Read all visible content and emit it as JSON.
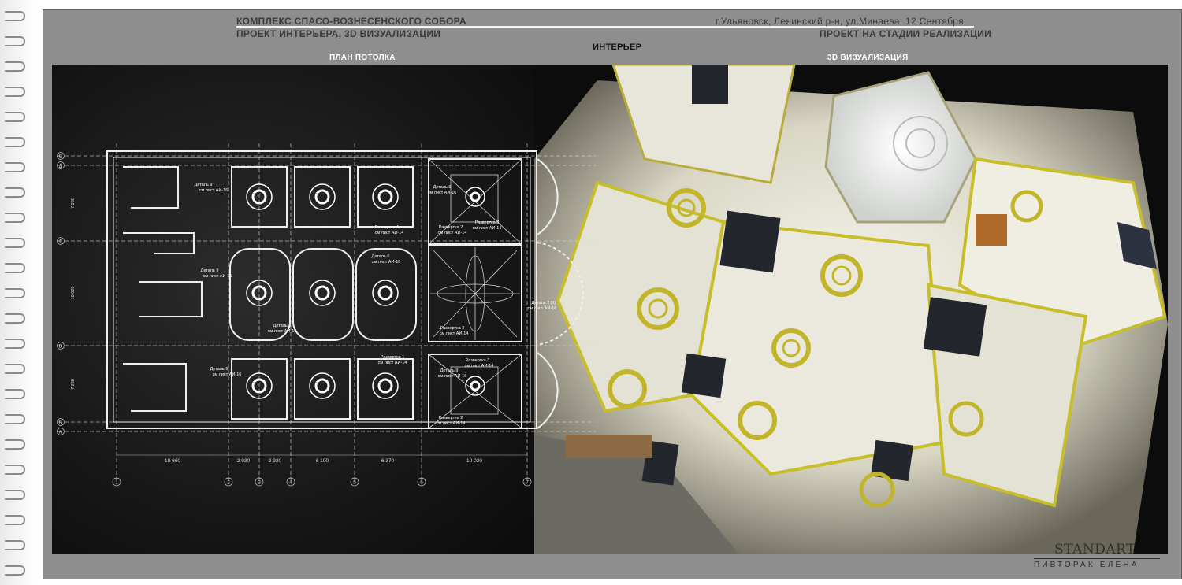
{
  "header": {
    "title_line1": "КОМПЛЕКС СПАСО-ВОЗНЕСЕНСКОГО СОБОРА",
    "title_line2": "ПРОЕКТ ИНТЕРЬЕРА, 3D ВИЗУАЛИЗАЦИИ",
    "address": "г.Ульяновск, Ленинский р-н, ул.Минаева, 12 Сентября",
    "status": "ПРОЕКТ НА СТАДИИ РЕАЛИЗАЦИИ",
    "section": "ИНТЕРЬЕР",
    "left_panel": "ПЛАН ПОТОЛКА",
    "right_panel": "3D ВИЗУАЛИЗАЦИЯ"
  },
  "plan": {
    "row_axes": [
      "Е",
      "Д",
      "Г",
      "В",
      "Б",
      "А"
    ],
    "col_axes": [
      "1",
      "2",
      "3",
      "4",
      "5",
      "6",
      "7"
    ],
    "dimensions_bottom": [
      "10 660",
      "2 930",
      "2 930",
      "6 100",
      "6 370",
      "10 020"
    ],
    "dimensions_left": [
      "7 280",
      "10 020",
      "7 280"
    ],
    "callouts": {
      "detail9_a": "Деталь 9",
      "sheet_a": "см лист АИ-16",
      "detail9_b": "Деталь 9",
      "sheet_b": "см лист АИ-16",
      "detail9_c": "Деталь 9",
      "sheet_c": "см лист АИ-16",
      "detail9_d": "Деталь 9",
      "sheet_d": "см лист АИ-16",
      "detail9_e": "Деталь 9",
      "sheet_e": "см лист АИ-16",
      "detail6": "Деталь 6",
      "sheet_6": "см лист АИ-16",
      "detail8": "Деталь 8",
      "sheet_8": "см лист АИ-16",
      "detail2": "Деталь 2 (1)",
      "sheet_2": "см лист АИ-16",
      "razv1_a": "Развертка 1",
      "rsheet1_a": "см лист АИ-14",
      "razv1_b": "Развертка 1",
      "rsheet1_b": "см лист АИ-14",
      "razv2_a": "Развертка 2",
      "rsheet2_a": "см лист АИ-14",
      "razv2_b": "Развертка 2",
      "rsheet2_b": "см лист АИ-14",
      "razv3_a": "Развертка 3",
      "rsheet3_a": "см лист АИ-14",
      "razv3_b": "Развертка 3",
      "rsheet3_b": "см лист АИ-14",
      "razv3_c": "Развертка 3",
      "rsheet3_c": "см лист АИ-14"
    }
  },
  "branding": {
    "logo": "STANDART",
    "author": "ПИВТОРАК ЕЛЕНА"
  }
}
